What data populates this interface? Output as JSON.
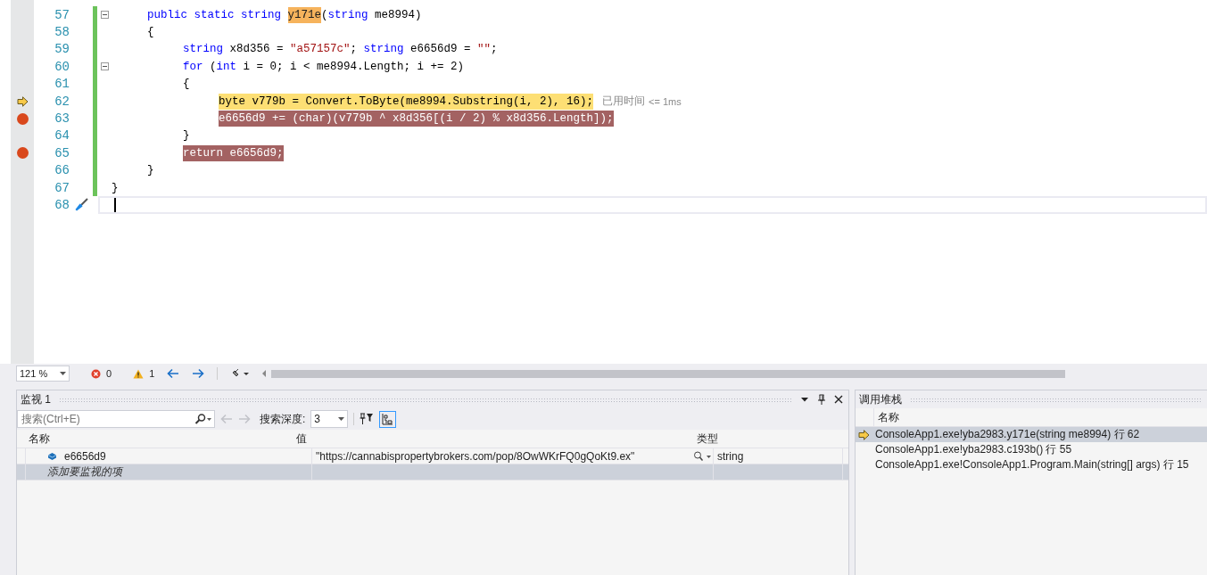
{
  "editor": {
    "lines": [
      {
        "number": "57",
        "current": false,
        "breakpoint": false,
        "collapsible": true,
        "tokens": [
          {
            "kind": "keyword",
            "text": "\tpublic static string "
          },
          {
            "kind": "reference",
            "text": "y171e"
          },
          {
            "kind": "plain",
            "text": "("
          },
          {
            "kind": "keyword",
            "text": "string"
          },
          {
            "kind": "plain",
            "text": " me8994)"
          }
        ]
      },
      {
        "number": "58",
        "current": false,
        "breakpoint": false,
        "collapsible": false,
        "tokens": [
          {
            "kind": "plain",
            "text": "\t{"
          }
        ]
      },
      {
        "number": "59",
        "current": false,
        "breakpoint": false,
        "collapsible": false,
        "tokens": [
          {
            "kind": "keyword",
            "text": "\t\tstring"
          },
          {
            "kind": "plain",
            "text": " x8d356 = "
          },
          {
            "kind": "string",
            "text": "\"a57157c\""
          },
          {
            "kind": "plain",
            "text": "; "
          },
          {
            "kind": "keyword",
            "text": "string"
          },
          {
            "kind": "plain",
            "text": " e6656d9 = "
          },
          {
            "kind": "string",
            "text": "\"\""
          },
          {
            "kind": "plain",
            "text": ";"
          }
        ]
      },
      {
        "number": "60",
        "current": false,
        "breakpoint": false,
        "collapsible": true,
        "tokens": [
          {
            "kind": "keyword",
            "text": "\t\tfor"
          },
          {
            "kind": "plain",
            "text": " ("
          },
          {
            "kind": "keyword",
            "text": "int"
          },
          {
            "kind": "plain",
            "text": " i = 0; i < me8994.Length; i += 2)"
          }
        ]
      },
      {
        "number": "61",
        "current": false,
        "breakpoint": false,
        "collapsible": false,
        "tokens": [
          {
            "kind": "plain",
            "text": "\t\t{"
          }
        ]
      },
      {
        "number": "62",
        "current": true,
        "breakpoint": false,
        "collapsible": false,
        "tokens": [
          {
            "kind": "plain",
            "text": "\t\t\tbyte v779b = Convert.ToByte(me8994.Substring(i, 2), 16);"
          }
        ],
        "hint": {
          "label": "已用时间",
          "value": "<= 1ms"
        }
      },
      {
        "number": "63",
        "current": false,
        "breakpoint": true,
        "collapsible": false,
        "tokens": [
          {
            "kind": "plain",
            "text": "\t\t\te6656d9 += (char)(v779b ^ x8d356[(i / 2) % x8d356.Length]);"
          }
        ]
      },
      {
        "number": "64",
        "current": false,
        "breakpoint": false,
        "collapsible": false,
        "tokens": [
          {
            "kind": "plain",
            "text": "\t\t}"
          }
        ]
      },
      {
        "number": "65",
        "current": false,
        "breakpoint": true,
        "collapsible": false,
        "tokens": [
          {
            "kind": "keyword",
            "text": "\t\treturn e6656d9;"
          }
        ]
      },
      {
        "number": "66",
        "current": false,
        "breakpoint": false,
        "collapsible": false,
        "tokens": [
          {
            "kind": "plain",
            "text": "\t}"
          }
        ]
      },
      {
        "number": "67",
        "current": false,
        "breakpoint": false,
        "collapsible": false,
        "tokens": [
          {
            "kind": "plain",
            "text": "}"
          }
        ]
      },
      {
        "number": "68",
        "current": false,
        "breakpoint": false,
        "collapsible": false,
        "caret": true,
        "quick_action": true
      }
    ]
  },
  "status": {
    "zoom": "121 %",
    "errors": "0",
    "warnings": "1"
  },
  "watch": {
    "title": "监视 1",
    "search": {
      "placeholder": "搜索(Ctrl+E)"
    },
    "depth_label": "搜索深度:",
    "depth": "3",
    "columns": [
      "名称",
      "值",
      "类型"
    ],
    "rows": [
      {
        "name": "e6656d9",
        "value": "\"https://cannabispropertybrokers.com/pop/8OwWKrFQ0gQoKt9.ex\"",
        "type": "string",
        "selected": false
      }
    ],
    "add_item": {
      "label": "添加要监视的项",
      "selected": true
    }
  },
  "call_stack": {
    "title": "调用堆栈",
    "column": "名称",
    "rows": [
      {
        "text": "ConsoleApp1.exe!yba2983.y171e(string me8994) 行 62",
        "current": true,
        "selected": true
      },
      {
        "text": "ConsoleApp1.exe!yba2983.c193b() 行 55",
        "current": false,
        "selected": false
      },
      {
        "text": "ConsoleApp1.exe!ConsoleApp1.Program.Main(string[] args) 行 15",
        "current": false,
        "selected": false
      }
    ]
  }
}
